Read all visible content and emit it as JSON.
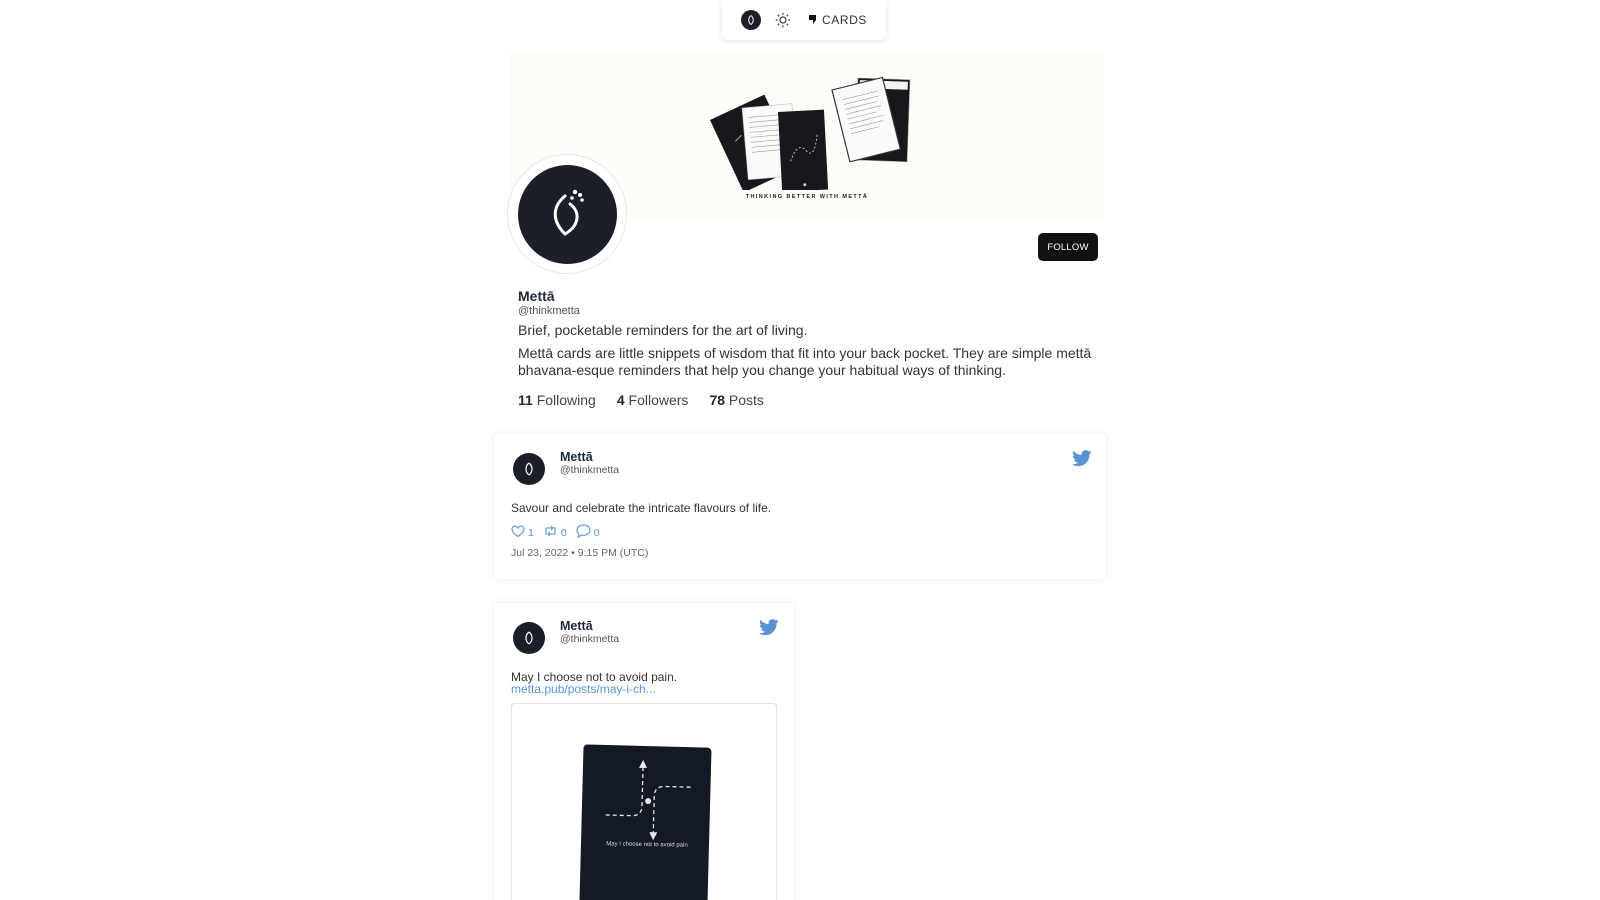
{
  "nav": {
    "logo_icon": "metta-logo-icon",
    "theme_icon": "sun-icon",
    "cards_icon": "card-stack-icon",
    "cards_label": "CARDS"
  },
  "profile": {
    "banner_tagline": "THINKING BETTER WITH METTĀ",
    "follow_label": "FOLLOW",
    "name": "Mettā",
    "handle": "@thinkmetta",
    "tagline": "Brief, pocketable reminders for the art of living.",
    "bio": "Mettā cards are little snippets of wisdom that fit into your back pocket. They are simple mettā bhavana-esque reminders that help you change your habitual ways of thinking.",
    "stats": {
      "following_count": "11",
      "following_label": "Following",
      "followers_count": "4",
      "followers_label": "Followers",
      "posts_count": "78",
      "posts_label": "Posts"
    }
  },
  "tweets": [
    {
      "name": "Mettā",
      "handle": "@thinkmetta",
      "text": "Savour and celebrate the intricate flavours of life.",
      "likes": "1",
      "retweets": "0",
      "replies": "0",
      "date": "Jul 23, 2022 • 9:15 PM (UTC)"
    },
    {
      "name": "Mettā",
      "handle": "@thinkmetta",
      "text": "May I choose not to avoid pain.",
      "link": "metta.pub/posts/may-i-ch...",
      "media_caption": "May I choose not to avoid pain"
    }
  ],
  "colors": {
    "brand_dark": "#1b1f28",
    "twitter_blue": "#5b93d1",
    "link_blue": "#5b93d1"
  }
}
